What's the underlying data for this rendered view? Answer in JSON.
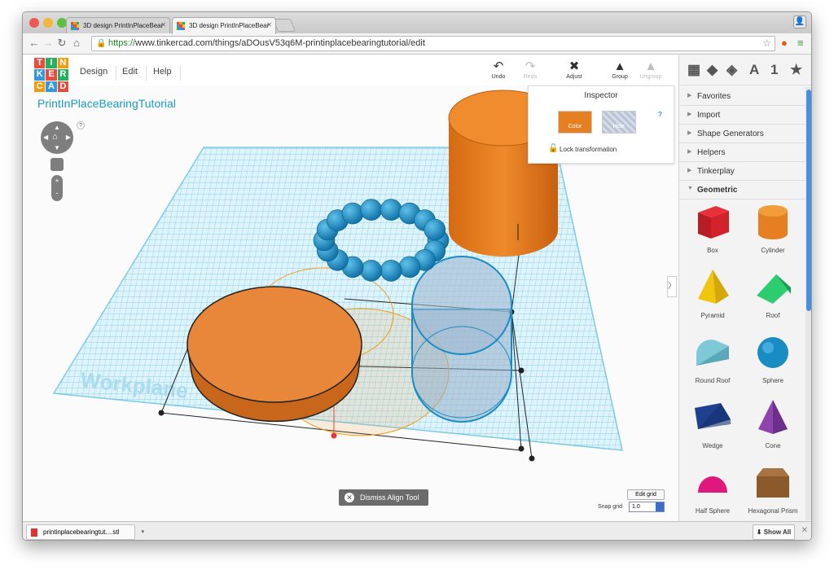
{
  "browser": {
    "tabs": [
      {
        "title": "3D design PrintInPlaceBear"
      },
      {
        "title": "3D design PrintInPlaceBear"
      }
    ],
    "url": {
      "scheme": "https://",
      "rest": "www.tinkercad.com/things/aDOusV53q6M-printinplacebearingtutorial/edit"
    }
  },
  "app": {
    "logo": [
      "T",
      "I",
      "N",
      "K",
      "E",
      "R",
      "C",
      "A",
      "D"
    ],
    "menu": [
      "Design",
      "Edit",
      "Help"
    ],
    "tools": {
      "undo": "Undo",
      "redo": "Redo",
      "adjust": "Adjust",
      "group": "Group",
      "ungroup": "Ungroup"
    },
    "design_title": "PrintInPlaceBearingTutorial",
    "view_help": "?"
  },
  "inspector": {
    "title": "Inspector",
    "color_label": "Color",
    "hole_label": "Hole",
    "lock_label": "Lock transformation",
    "help": "?"
  },
  "workplane_label": "Workplane",
  "bottom": {
    "dismiss": "Dismiss Align Tool",
    "edit_grid": "Edit grid",
    "snap_label": "Snap grid",
    "snap_value": "1.0"
  },
  "panel": {
    "top_icons": [
      "A",
      "1"
    ],
    "categories": [
      "Favorites",
      "Import",
      "Shape Generators",
      "Helpers",
      "Tinkerplay",
      "Geometric"
    ],
    "shapes": [
      "Box",
      "Cylinder",
      "Pyramid",
      "Roof",
      "Round Roof",
      "Sphere",
      "Wedge",
      "Cone",
      "Half Sphere",
      "Hexagonal Prism"
    ]
  },
  "downloads": {
    "file": "printinplacebearingtut....stl",
    "show_all": "Show All"
  },
  "colors": {
    "accent": "#1a9ac6",
    "orange": "#e67e22",
    "grid": "#8fd3ec",
    "bead": "#1a8cc4",
    "ghost": "#9ab8cf"
  }
}
